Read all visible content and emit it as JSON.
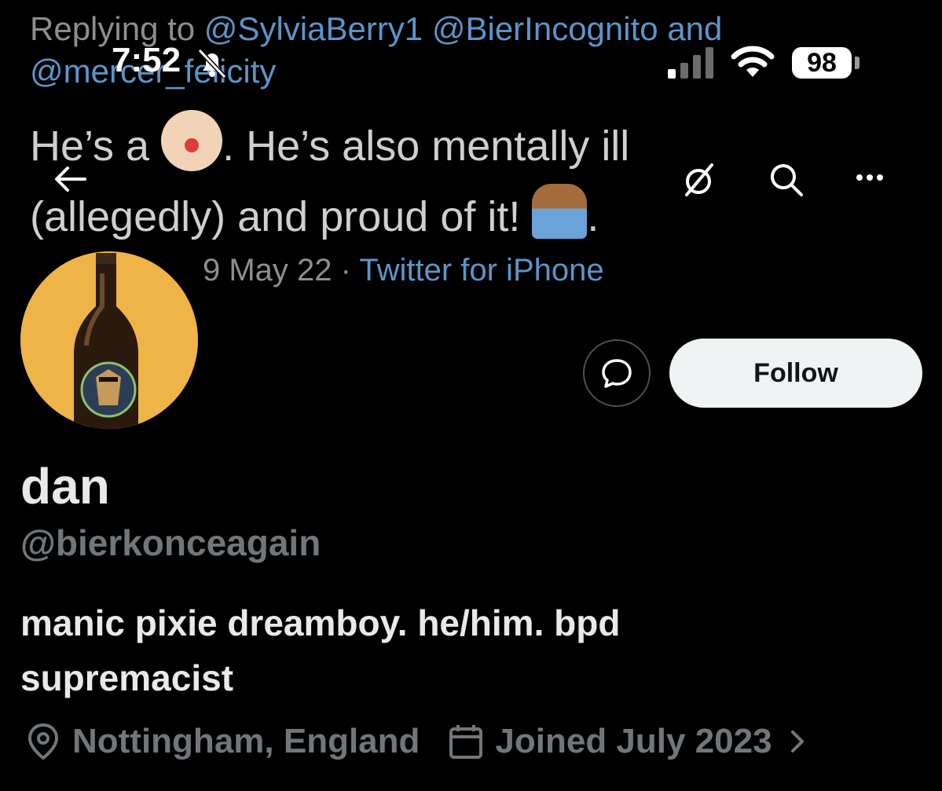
{
  "status_bar": {
    "time": "7:52",
    "battery": "98"
  },
  "background_tweet": {
    "replying_to_prefix": "Replying to",
    "mention_1": "@SylviaBerry1",
    "mention_2": "@BierIncognito",
    "and": "and",
    "mention_3": "@mercer_felicity",
    "text_part_1": "He’s a",
    "text_part_2": ". He’s also mentally ill",
    "text_part_3": "(allegedly) and proud of it!",
    "text_part_4": ".",
    "date": "9 May 22 ·",
    "source": "Twitter for iPhone"
  },
  "actions": {
    "follow_label": "Follow"
  },
  "profile": {
    "display_name": "dan",
    "handle": "@bierkonceagain",
    "bio_line_1": "manic pixie dreamboy. he/him. bpd",
    "bio_line_2": "supremacist",
    "location": "Nottingham, England",
    "joined": "Joined July 2023"
  },
  "icons": [
    "bell-slash-icon",
    "signal-icon",
    "wifi-icon",
    "back-arrow-icon",
    "hide-icon",
    "search-icon",
    "more-icon",
    "message-icon",
    "location-pin-icon",
    "calendar-icon",
    "chevron-right-icon"
  ],
  "colors": {
    "background": "#000000",
    "link_blue": "#5b95c9",
    "follow_bg": "#eff3f4",
    "muted": "#71767b",
    "avatar_bg": "#eeb447"
  }
}
